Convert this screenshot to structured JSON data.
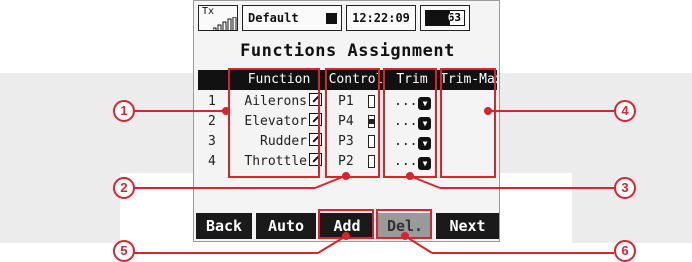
{
  "status": {
    "tx_label": "Tx",
    "model_name": "Default",
    "time": "12:22:09",
    "battery_percent": 63,
    "battery_text": "63"
  },
  "screen_title": "Functions Assignment",
  "columns": [
    "Function",
    "Control",
    "Trim",
    "Trim-Max"
  ],
  "rows": [
    {
      "num": "1",
      "function": "Ailerons",
      "control": "P1",
      "control_level": 0.0,
      "trim": "..."
    },
    {
      "num": "2",
      "function": "Elevator",
      "control": "P4",
      "control_level": 0.5,
      "trim": "..."
    },
    {
      "num": "3",
      "function": "Rudder",
      "control": "P3",
      "control_level": 0.0,
      "trim": "..."
    },
    {
      "num": "4",
      "function": "Throttle",
      "control": "P2",
      "control_level": 0.0,
      "trim": "..."
    }
  ],
  "buttons": {
    "back": "Back",
    "auto": "Auto",
    "add": "Add",
    "del": "Del.",
    "next": "Next"
  },
  "callouts": [
    "1",
    "2",
    "3",
    "4",
    "5",
    "6"
  ],
  "colors": {
    "callout": "#d9232d",
    "screen_bg": "#f4f4f4",
    "header_bg": "#111111"
  }
}
